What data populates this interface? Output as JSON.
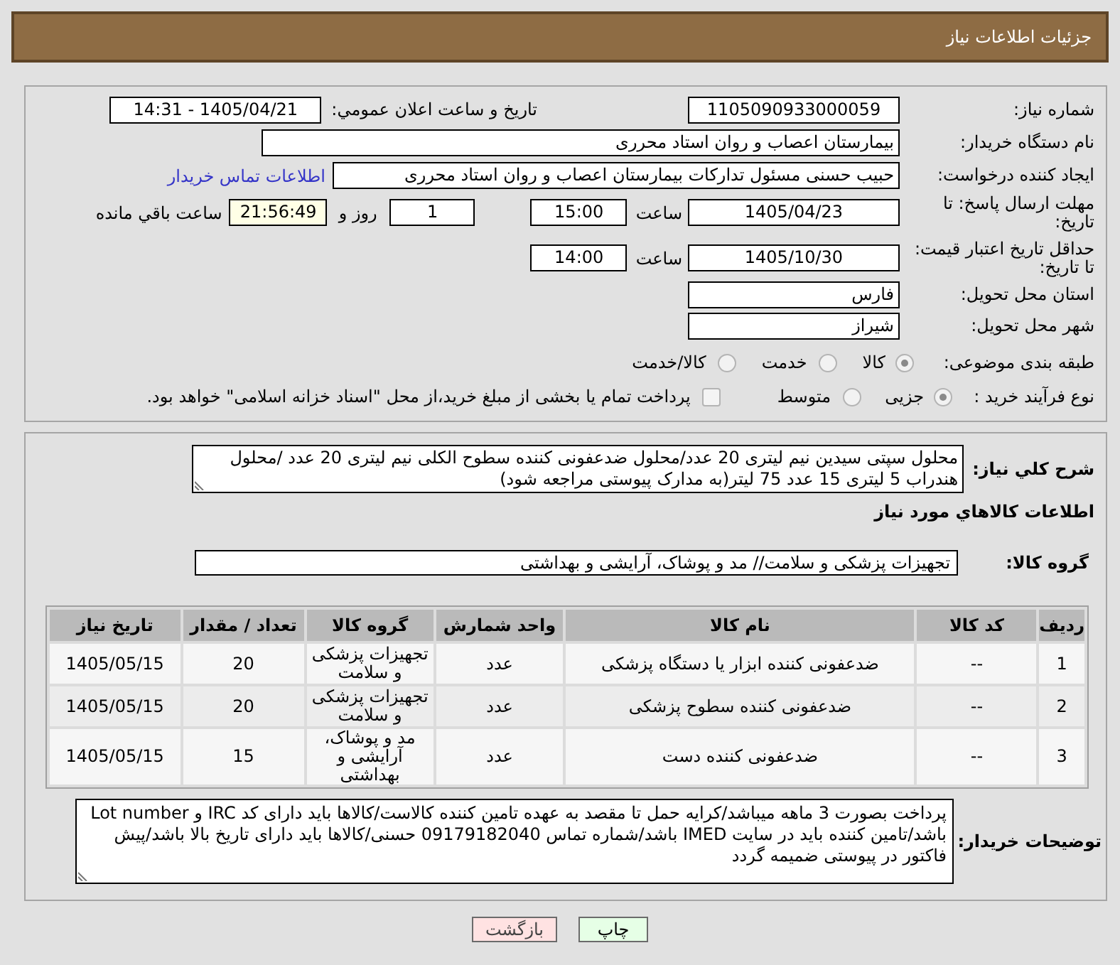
{
  "header": {
    "title": "جزئیات اطلاعات نیاز"
  },
  "details": {
    "need_number": {
      "label": "شماره نیاز:",
      "value": "1105090933000059"
    },
    "announcement": {
      "label": "تاریخ و ساعت اعلان عمومي:",
      "value": "1405/04/21 - 14:31"
    },
    "buyer": {
      "label": "نام دستگاه خریدار:",
      "value": "بیمارستان اعصاب و روان استاد محرری"
    },
    "requester": {
      "label": "ایجاد کننده درخواست:",
      "value": "حبیب حسنی مسئول تدارکات بیمارستان اعصاب و روان استاد محرری",
      "contact_link": "اطلاعات تماس خریدار"
    },
    "reply_deadline": {
      "label": "مهلت ارسال پاسخ: تا تاریخ:",
      "date": "1405/04/23",
      "time_label": "ساعت",
      "time": "15:00",
      "days": "1",
      "days_label": "روز و",
      "remaining": "21:56:49",
      "remaining_label": "ساعت باقي مانده"
    },
    "price_validity": {
      "label": "حداقل تاریخ اعتبار قیمت: تا تاریخ:",
      "date": "1405/10/30",
      "time_label": "ساعت",
      "time": "14:00"
    },
    "province": {
      "label": "استان محل تحویل:",
      "value": "فارس"
    },
    "city": {
      "label": "شهر محل تحویل:",
      "value": "شیراز"
    },
    "category": {
      "label": "طبقه بندی موضوعی:",
      "options": [
        {
          "label": "کالا",
          "selected": true
        },
        {
          "label": "خدمت",
          "selected": false
        },
        {
          "label": "کالا/خدمت",
          "selected": false
        }
      ]
    },
    "purchase_process": {
      "label": "نوع فرآیند خرید :",
      "options": [
        {
          "label": "جزیی",
          "selected": true
        },
        {
          "label": "متوسط",
          "selected": false
        }
      ],
      "treasury_payment": {
        "label": "پرداخت تمام یا بخشی از مبلغ خرید،از محل \"اسناد خزانه اسلامی\" خواهد بود.",
        "checked": false
      }
    }
  },
  "items": {
    "description_label": "شرح کلي نیاز:",
    "description": "محلول سپتی سیدین نیم لیتری 20 عدد/محلول ضدعفونی کننده سطوح الکلی نیم لیتری 20 عدد /محلول هندراب 5 لیتری 15 عدد 75 لیتر(به مدارک پیوستی مراجعه شود)",
    "section_title": "اطلاعات کالاهاي مورد نیاز",
    "group_label": "گروه کالا:",
    "group": "تجهیزات پزشکی و سلامت// مد و پوشاک، آرایشی و بهداشتی",
    "table": {
      "columns": [
        "ردیف",
        "کد کالا",
        "نام کالا",
        "واحد شمارش",
        "گروه کالا",
        "تعداد / مقدار",
        "تاریخ نیاز"
      ],
      "rows": [
        [
          "1",
          "--",
          "ضدعفونی کننده ابزار یا دستگاه پزشکی",
          "عدد",
          "تجهیزات پزشکی و سلامت",
          "20",
          "1405/05/15"
        ],
        [
          "2",
          "--",
          "ضدعفونی کننده سطوح پزشکی",
          "عدد",
          "تجهیزات پزشکی و سلامت",
          "20",
          "1405/05/15"
        ],
        [
          "3",
          "--",
          "ضدعفونی کننده دست",
          "عدد",
          "مد و پوشاک، آرایشی و بهداشتی",
          "15",
          "1405/05/15"
        ]
      ]
    },
    "notes_label": "توضیحات خریدار:",
    "notes": "پرداخت بصورت 3 ماهه میباشد/کرایه حمل تا مقصد به عهده تامین کننده کالاست/کالاها باید دارای کد IRC و Lot number باشد/تامین کننده باید در سایت IMED باشد/شماره تماس 09179182040 حسنی/کالاها باید دارای تاریخ بالا باشد/پیش فاکتور در پیوستی ضمیمه گردد"
  },
  "buttons": [
    {
      "label": "چاپ",
      "kind": "print"
    },
    {
      "label": "بازگشت",
      "kind": "back"
    }
  ]
}
